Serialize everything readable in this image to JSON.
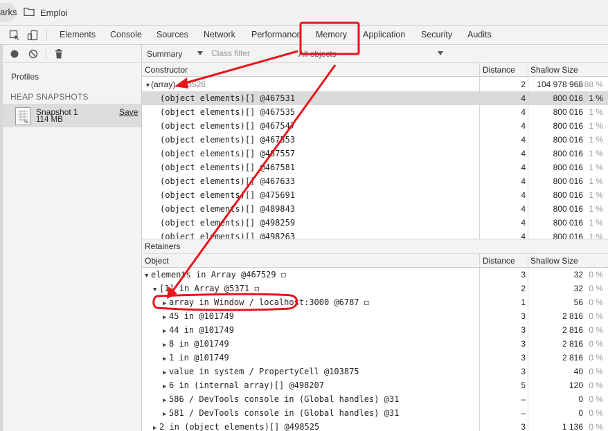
{
  "bookmarks": {
    "cut_label": "arks",
    "folder_label": "Emploi"
  },
  "devtools": {
    "tabs": [
      "Elements",
      "Console",
      "Sources",
      "Network",
      "Performance",
      "Memory",
      "Application",
      "Security",
      "Audits"
    ],
    "active_tab": "Memory"
  },
  "profiles": {
    "title": "Profiles",
    "section": "HEAP SNAPSHOTS",
    "snapshot_name": "Snapshot 1",
    "snapshot_size": "114 MB",
    "save_label": "Save"
  },
  "filter": {
    "view": "Summary",
    "class_filter_placeholder": "Class filter",
    "objects": "All objects"
  },
  "constructor_table": {
    "headers": {
      "name": "Constructor",
      "distance": "Distance",
      "shallow": "Shallow Size"
    },
    "rows": [
      {
        "name": "(array)",
        "count": "×53526",
        "distance": "2",
        "size": "104 978 968",
        "pct": "88 %"
      },
      {
        "name": "(object elements)[] @467531",
        "distance": "4",
        "size": "800 016",
        "pct": "1 %"
      },
      {
        "name": "(object elements)[] @467535",
        "distance": "4",
        "size": "800 016",
        "pct": "1 %"
      },
      {
        "name": "(object elements)[] @467547",
        "distance": "4",
        "size": "800 016",
        "pct": "1 %"
      },
      {
        "name": "(object elements)[] @467553",
        "distance": "4",
        "size": "800 016",
        "pct": "1 %"
      },
      {
        "name": "(object elements)[] @467557",
        "distance": "4",
        "size": "800 016",
        "pct": "1 %"
      },
      {
        "name": "(object elements)[] @467581",
        "distance": "4",
        "size": "800 016",
        "pct": "1 %"
      },
      {
        "name": "(object elements)[] @467633",
        "distance": "4",
        "size": "800 016",
        "pct": "1 %"
      },
      {
        "name": "(object elements)[] @475691",
        "distance": "4",
        "size": "800 016",
        "pct": "1 %"
      },
      {
        "name": "(object elements)[] @489843",
        "distance": "4",
        "size": "800 016",
        "pct": "1 %"
      },
      {
        "name": "(object elements)[] @498259",
        "distance": "4",
        "size": "800 016",
        "pct": "1 %"
      },
      {
        "name": "(object elements)[] @498263",
        "distance": "4",
        "size": "800 016",
        "pct": "1 %"
      }
    ]
  },
  "retainers": {
    "title": "Retainers",
    "headers": {
      "name": "Object",
      "distance": "Distance",
      "shallow": "Shallow Size"
    },
    "rows": [
      {
        "name": "elements in Array @467529 ◻",
        "distance": "3",
        "size": "32",
        "pct": "0 %"
      },
      {
        "name": "[1] in Array @5371 ◻",
        "distance": "2",
        "size": "32",
        "pct": "0 %"
      },
      {
        "name": "array in Window / localhost:3000 @6787 ◻",
        "distance": "1",
        "size": "56",
        "pct": "0 %"
      },
      {
        "name": "45 in  @101749",
        "distance": "3",
        "size": "2 816",
        "pct": "0 %"
      },
      {
        "name": "44 in  @101749",
        "distance": "3",
        "size": "2 816",
        "pct": "0 %"
      },
      {
        "name": "8 in  @101749",
        "distance": "3",
        "size": "2 816",
        "pct": "0 %"
      },
      {
        "name": "1 in  @101749",
        "distance": "3",
        "size": "2 816",
        "pct": "0 %"
      },
      {
        "name": "value in system / PropertyCell @103875",
        "distance": "3",
        "size": "40",
        "pct": "0 %"
      },
      {
        "name": "6 in (internal array)[] @498207",
        "distance": "5",
        "size": "120",
        "pct": "0 %"
      },
      {
        "name": "586 / DevTools console in (Global handles) @31",
        "distance": "–",
        "size": "0",
        "pct": "0 %"
      },
      {
        "name": "581 / DevTools console in (Global handles) @31",
        "distance": "–",
        "size": "0",
        "pct": "0 %"
      },
      {
        "name": "2 in (object elements)[] @498525",
        "distance": "3",
        "size": "1 136",
        "pct": "0 %"
      }
    ]
  },
  "colors": {
    "annotation_red": "#e8141a",
    "selected_row": "#dadada"
  }
}
